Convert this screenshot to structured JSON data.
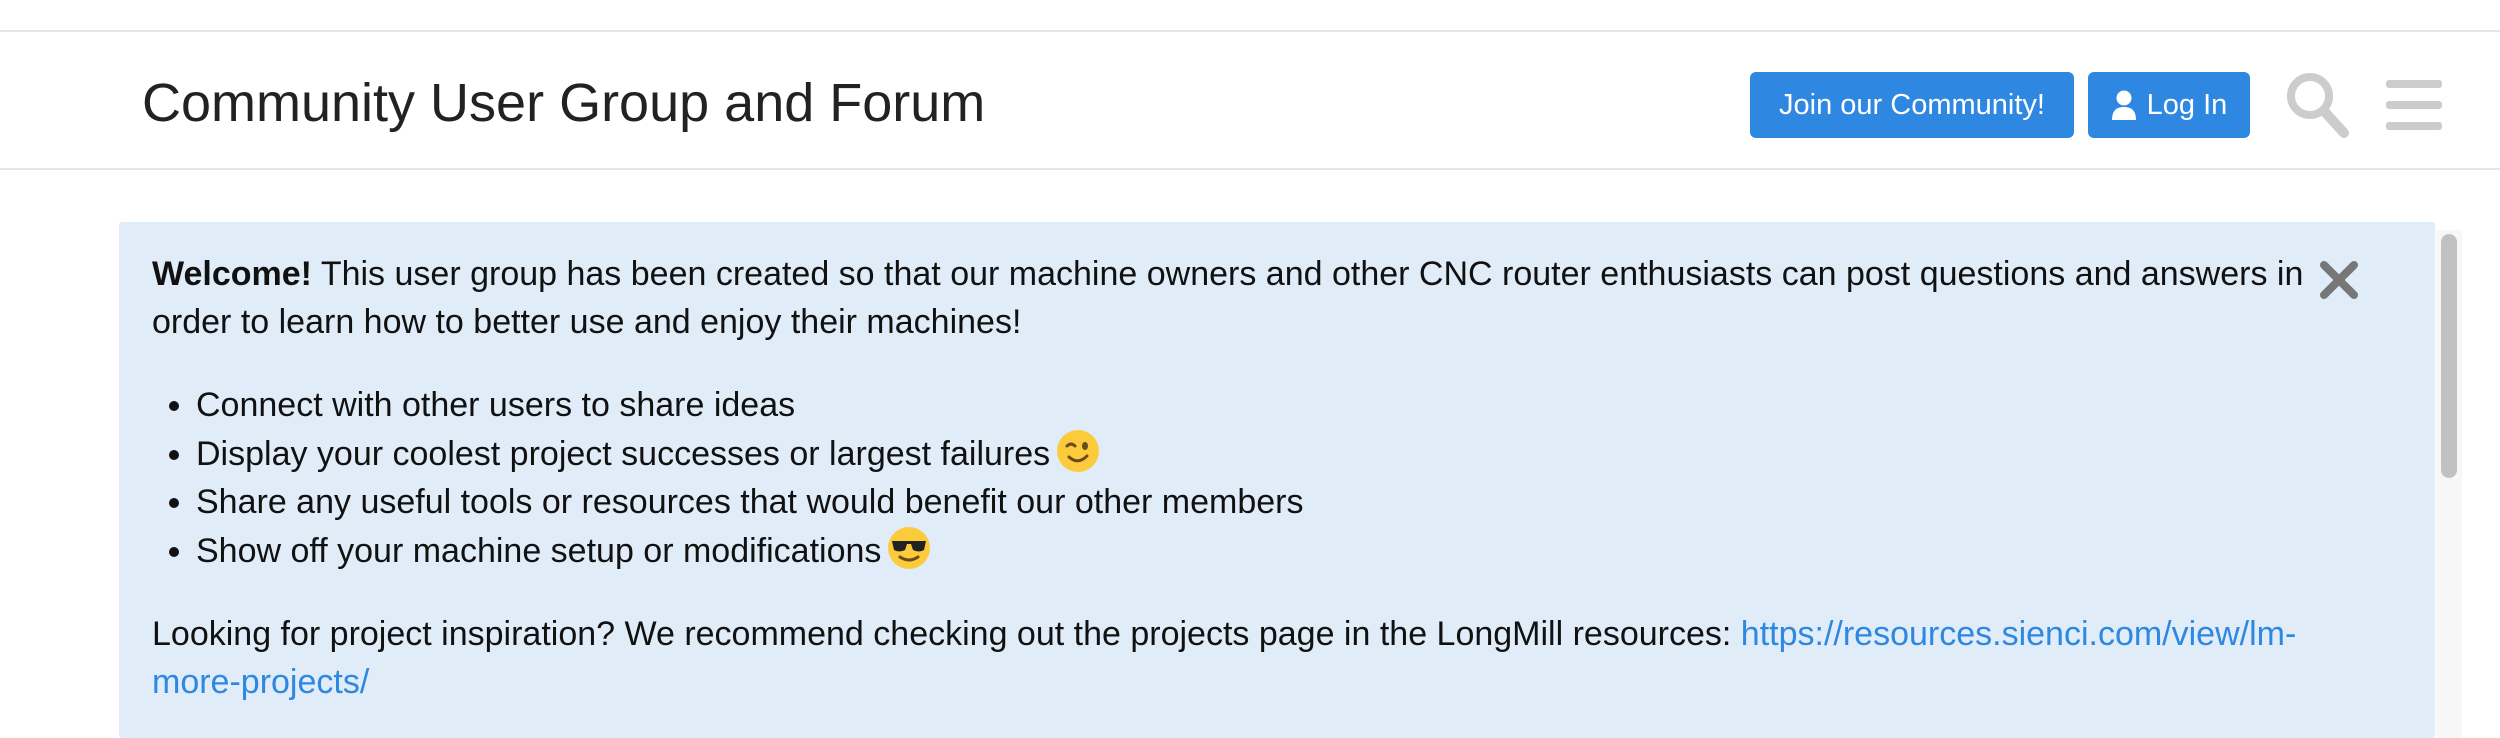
{
  "header": {
    "title": "Community User Group and Forum",
    "join_label": "Join our Community!",
    "login_label": "Log In"
  },
  "icons": {
    "user": "user-icon",
    "search": "search-icon",
    "menu": "hamburger-menu-icon",
    "close": "close-icon",
    "wink": "winking-face-emoji",
    "cool": "sunglasses-face-emoji"
  },
  "colors": {
    "accent": "#2e87e0",
    "notice_bg": "#e0edf9",
    "icon_gray": "#cccccc",
    "close_gray": "#777777"
  },
  "notice": {
    "welcome_bold": "Welcome!",
    "intro": " This user group has been created so that our machine owners and other CNC router enthusiasts can post questions and answers in order to learn how to better use and enjoy their machines!",
    "bullets": [
      "Connect with other users to share ideas",
      "Display your coolest project successes or largest failures",
      "Share any useful tools or resources that would benefit our other members",
      "Show off your machine setup or modifications"
    ],
    "inspiration_text": "Looking for project inspiration? We recommend checking out the projects page in the LongMill resources: ",
    "inspiration_link": "https://resources.sienci.com/view/lm-more-projects/"
  }
}
